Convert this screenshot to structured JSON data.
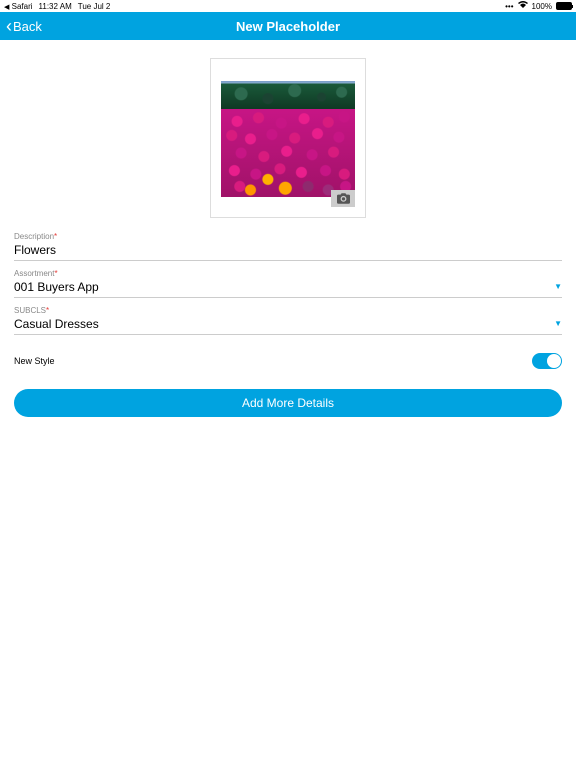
{
  "status": {
    "app": "Safari",
    "time": "11:32 AM",
    "date": "Tue Jul 2",
    "battery": "100%"
  },
  "header": {
    "back_label": "Back",
    "title": "New Placeholder"
  },
  "form": {
    "description": {
      "label": "Description",
      "value": "Flowers"
    },
    "assortment": {
      "label": "Assortment",
      "value": "001 Buyers App"
    },
    "subcls": {
      "label": "SUBCLS",
      "value": "Casual Dresses"
    },
    "new_style": {
      "label": "New Style",
      "on": true
    }
  },
  "buttons": {
    "add_more": "Add More Details"
  }
}
